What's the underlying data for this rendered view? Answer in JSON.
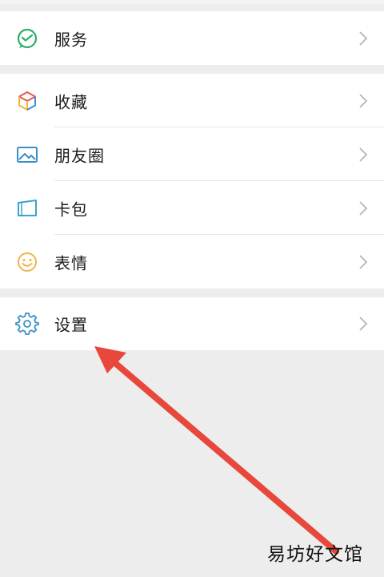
{
  "menu": {
    "services": {
      "label": "服务",
      "icon": "wechat-pay-icon"
    },
    "favorites": {
      "label": "收藏",
      "icon": "cube-icon"
    },
    "moments": {
      "label": "朋友圈",
      "icon": "picture-icon"
    },
    "cards": {
      "label": "卡包",
      "icon": "card-icon"
    },
    "stickers": {
      "label": "表情",
      "icon": "smiley-icon"
    },
    "settings": {
      "label": "设置",
      "icon": "gear-icon"
    }
  },
  "annotation": {
    "color": "#e8473c",
    "description_icon": "red-arrow-pointing-to-settings"
  },
  "watermark": "易坊好文馆"
}
